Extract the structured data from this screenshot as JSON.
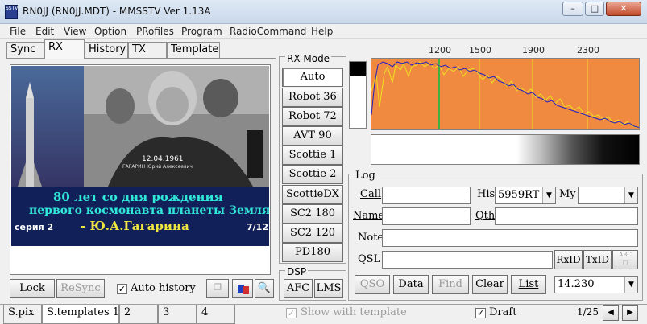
{
  "window": {
    "title": "RN0JJ (RN0JJ.MDT) - MMSSTV Ver 1.13A",
    "app_icon": "SSTV",
    "controls": [
      "minimize-icon",
      "maximize-icon",
      "close-icon"
    ]
  },
  "menu": [
    "File",
    "Edit",
    "View",
    "Option",
    "PRofiles",
    "Program",
    "RadioCommand",
    "Help"
  ],
  "tabs": [
    "Sync",
    "RX",
    "History",
    "TX",
    "Template"
  ],
  "active_tab": "RX",
  "picture": {
    "date_overlay": "12.04.1961",
    "caption_small": "ГАГАРИН Юрий Алексеевич",
    "headline1": "80 лет со дня рождения",
    "headline2": "первого космонавта планеты Земля",
    "headline3": "- Ю.А.Гагарина",
    "series": "серия 2",
    "counter": "7/12"
  },
  "rx_controls": {
    "lock": "Lock",
    "resync": "ReSync",
    "auto_history_label": "Auto history",
    "auto_history_checked": true
  },
  "rx_mode": {
    "title": "RX Mode",
    "modes": [
      "Auto",
      "Robot 36",
      "Robot 72",
      "AVT 90",
      "Scottie 1",
      "Scottie 2",
      "ScottieDX",
      "SC2 180",
      "SC2 120",
      "PD180"
    ],
    "selected": "Auto"
  },
  "dsp": {
    "title": "DSP",
    "afc": "AFC",
    "lms": "LMS"
  },
  "spectrum": {
    "freq_labels": [
      "1200",
      "1500",
      "1900",
      "2300"
    ],
    "colors": {
      "background": "#f08a40",
      "trace_blue": "#2020c0",
      "trace_yellow": "#f0e020",
      "marker_green": "#40b040"
    }
  },
  "log": {
    "title": "Log",
    "call_label": "Call",
    "call_value": "",
    "his_label": "His",
    "his_value": "5959RT",
    "my_label": "My",
    "my_value": "",
    "name_label": "Name",
    "name_value": "",
    "qth_label": "Qth",
    "qth_value": "",
    "note_label": "Note",
    "note_value": "",
    "qsl_label": "QSL",
    "qsl_value": "",
    "rxid": "RxID",
    "txid": "TxID",
    "abc_icon": "abc-icon",
    "buttons": {
      "qso": "QSO",
      "data": "Data",
      "find": "Find",
      "clear": "Clear",
      "list": "List"
    },
    "freq_value": "14.230"
  },
  "bottom": {
    "tabs": [
      "S.pix",
      "S.templates 1",
      "2",
      "3",
      "4"
    ],
    "active_tab": "S.templates 1",
    "show_with_template": "Show with template",
    "draft": "Draft",
    "draft_checked": true,
    "page": "1/25"
  }
}
